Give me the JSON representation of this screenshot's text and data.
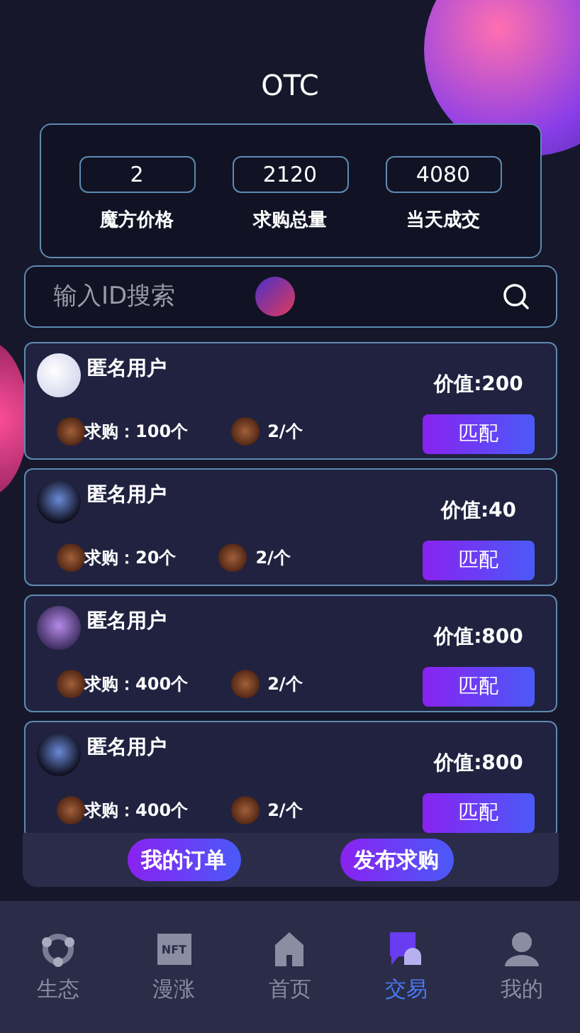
{
  "header": {
    "title": "OTC"
  },
  "stats": [
    {
      "value": "2",
      "label": "魔方价格"
    },
    {
      "value": "2120",
      "label": "求购总量"
    },
    {
      "value": "4080",
      "label": "当天成交"
    }
  ],
  "search": {
    "placeholder": "输入ID搜索"
  },
  "orders": [
    {
      "user": "匿名用户",
      "quantity": "求购：100个",
      "unit_price": "2/个",
      "value": "价值:200",
      "action": "匹配"
    },
    {
      "user": "匿名用户",
      "quantity": "求购：20个",
      "unit_price": "2/个",
      "value": "价值:40",
      "action": "匹配"
    },
    {
      "user": "匿名用户",
      "quantity": "求购：400个",
      "unit_price": "2/个",
      "value": "价值:800",
      "action": "匹配"
    },
    {
      "user": "匿名用户",
      "quantity": "求购：400个",
      "unit_price": "2/个",
      "value": "价值:800",
      "action": "匹配"
    }
  ],
  "actions": [
    "我的订单",
    "发布求购"
  ],
  "tabs": [
    {
      "label": "生态",
      "selected": false
    },
    {
      "label": "漫涨",
      "icon_text": "NFT",
      "selected": false
    },
    {
      "label": "首页",
      "selected": false
    },
    {
      "label": "交易",
      "selected": true
    },
    {
      "label": "我的",
      "selected": false
    }
  ]
}
